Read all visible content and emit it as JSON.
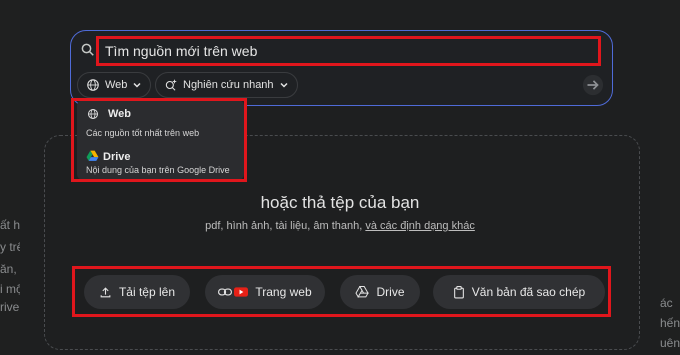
{
  "search": {
    "query": "Tìm nguồn mới trên web",
    "source_chip": "Web",
    "mode_chip": "Nghiên cứu nhanh"
  },
  "dropdown": {
    "items": [
      {
        "title": "Web",
        "desc": "Các nguồn tốt nhất trên web",
        "icon": "globe-icon"
      },
      {
        "title": "Drive",
        "desc": "Nội dung của bạn trên Google Drive",
        "icon": "google-drive-icon"
      }
    ]
  },
  "dropzone": {
    "title": "hoặc thả tệp của bạn",
    "subtitle": "pdf, hình ảnh, tài liệu, âm thanh, ",
    "link": "và các định dạng khác"
  },
  "actions": [
    {
      "label": "Tải tệp lên",
      "icon": "upload-icon"
    },
    {
      "label": "Trang web",
      "icon": "link-youtube-icon"
    },
    {
      "label": "Drive",
      "icon": "drive-icon"
    },
    {
      "label": "Văn bản đã sao chép",
      "icon": "clipboard-icon"
    }
  ],
  "background_fragments": {
    "left": [
      "ất hiệ",
      "y trên",
      "ăn, vi",
      "i một",
      "rive."
    ],
    "right": [
      "ác",
      "hến",
      "uên"
    ]
  },
  "colors": {
    "highlight": "#e0161c",
    "search_border": "#4f6bd8",
    "background": "#1f2020"
  }
}
